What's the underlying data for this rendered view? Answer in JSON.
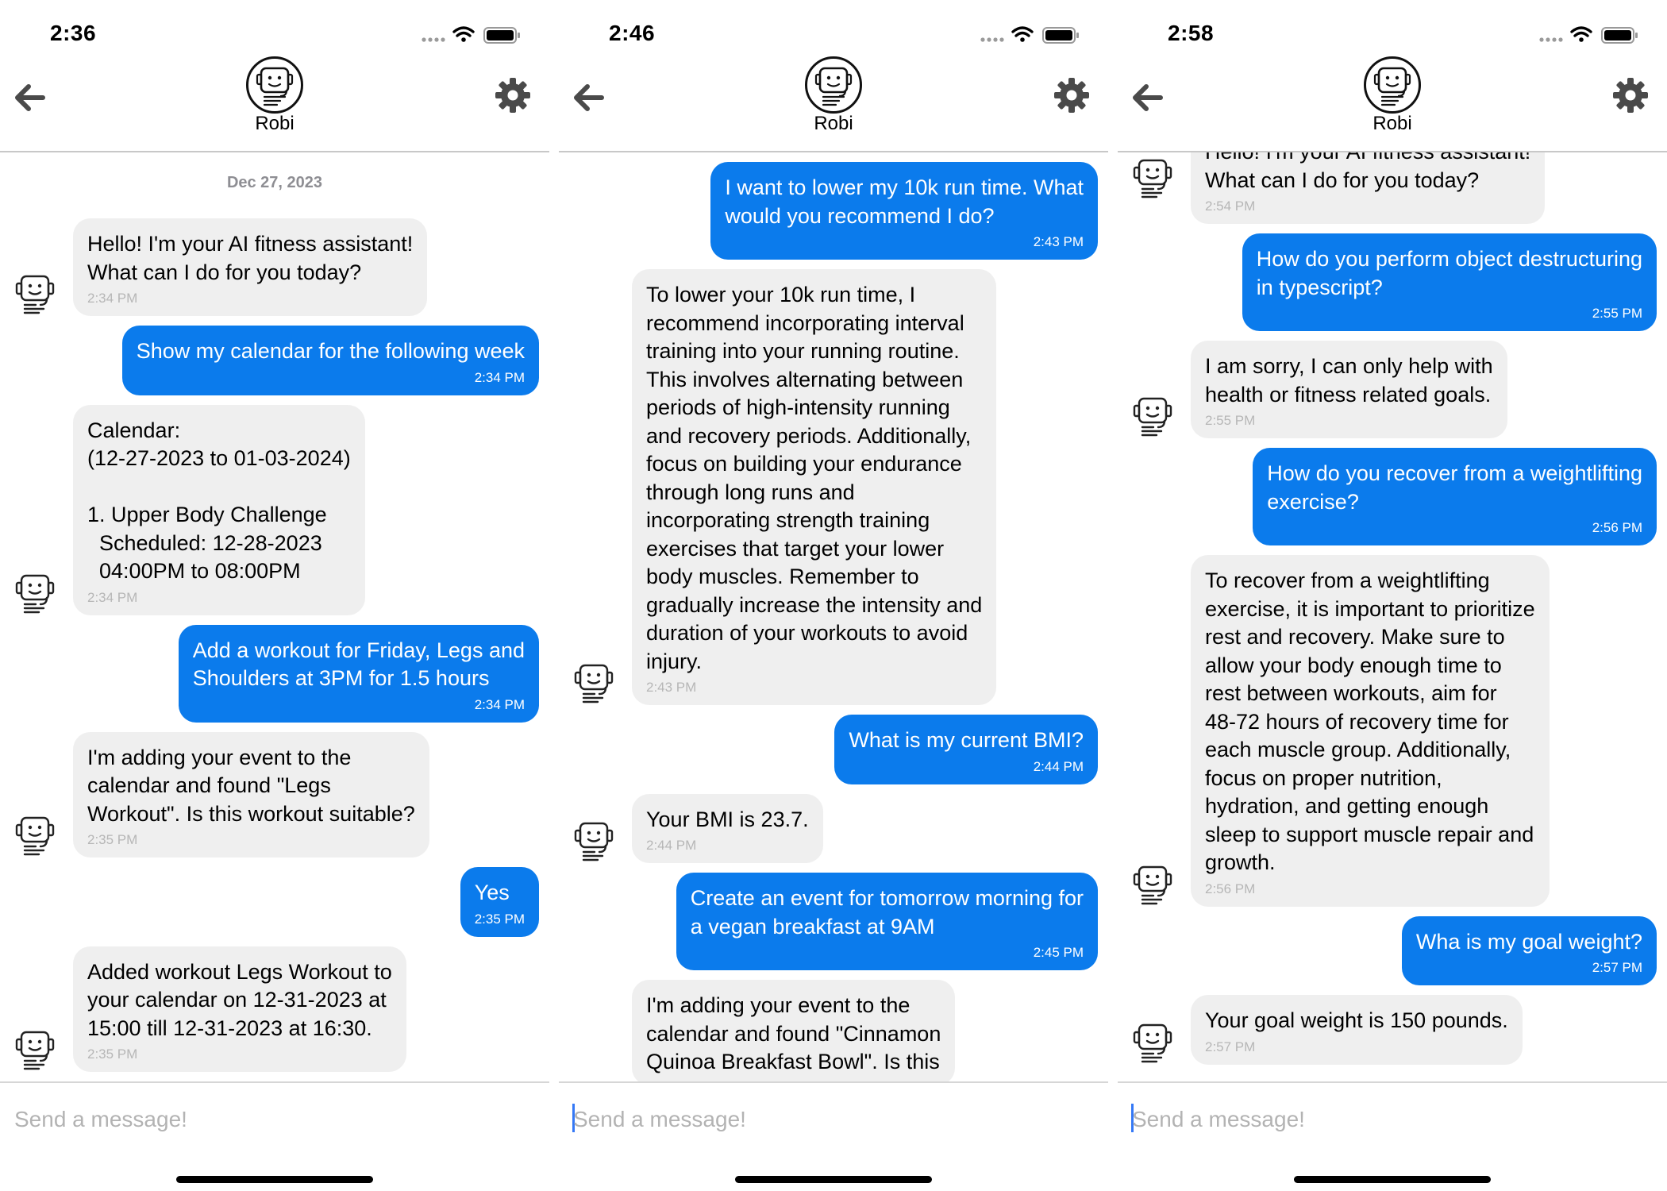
{
  "colors": {
    "outgoing_bubble": "#0b7bec",
    "incoming_bubble": "#efefef",
    "timestamp_gray": "#b6b6b6"
  },
  "screens": [
    {
      "time": "2:36",
      "header": {
        "name": "Robi",
        "back_icon": "arrow-left-icon",
        "settings_icon": "gear-icon"
      },
      "date_label": "Dec 27, 2023",
      "messages": [
        {
          "from": "bot",
          "text": "Hello! I'm your AI fitness assistant!\nWhat can I do for you today?",
          "time": "2:34 PM"
        },
        {
          "from": "user",
          "text": "Show my calendar for the following week",
          "time": "2:34 PM"
        },
        {
          "from": "bot",
          "text": "Calendar:\n(12-27-2023 to 01-03-2024)\n\n1. Upper Body Challenge\n  Scheduled: 12-28-2023\n  04:00PM to 08:00PM",
          "time": "2:34 PM"
        },
        {
          "from": "user",
          "text": "Add a workout for Friday, Legs and\nShoulders at 3PM for 1.5 hours",
          "time": "2:34 PM"
        },
        {
          "from": "bot",
          "text": "I'm adding your event to the\ncalendar and found \"Legs\nWorkout\". Is this workout suitable?",
          "time": "2:35 PM"
        },
        {
          "from": "user",
          "text": "Yes",
          "time": "2:35 PM"
        },
        {
          "from": "bot",
          "text": "Added workout Legs Workout to\nyour calendar on 12-31-2023 at\n15:00 till 12-31-2023 at 16:30.",
          "time": "2:35 PM"
        }
      ],
      "composer": {
        "placeholder": "Send a message!"
      }
    },
    {
      "time": "2:46",
      "header": {
        "name": "Robi",
        "back_icon": "arrow-left-icon",
        "settings_icon": "gear-icon"
      },
      "messages": [
        {
          "from": "user",
          "text": "I want to lower my 10k run time. What\nwould you recommend I do?",
          "time": "2:43 PM"
        },
        {
          "from": "bot",
          "text": "To lower your 10k run time, I\nrecommend incorporating interval\ntraining into your running routine.\nThis involves alternating between\nperiods of high-intensity running\nand recovery periods. Additionally,\nfocus on building your endurance\nthrough long runs and\nincorporating strength training\nexercises that target your lower\nbody muscles. Remember to\ngradually increase the intensity and\nduration of your workouts to avoid\ninjury.",
          "time": "2:43 PM"
        },
        {
          "from": "user",
          "text": "What is my current BMI?",
          "time": "2:44 PM"
        },
        {
          "from": "bot",
          "text": "Your BMI is 23.7.",
          "time": "2:44 PM"
        },
        {
          "from": "user",
          "text": "Create an event for tomorrow morning for\na vegan breakfast at 9AM",
          "time": "2:45 PM"
        },
        {
          "from": "bot",
          "text": "I'm adding your event to the\ncalendar and found \"Cinnamon\nQuinoa Breakfast Bowl\". Is this",
          "time": ""
        }
      ],
      "composer": {
        "placeholder": "Send a message!"
      }
    },
    {
      "time": "2:58",
      "header": {
        "name": "Robi",
        "back_icon": "arrow-left-icon",
        "settings_icon": "gear-icon"
      },
      "messages": [
        {
          "from": "bot",
          "text": "Hello! I'm your AI fitness assistant!\nWhat can I do for you today?",
          "time": "2:54 PM"
        },
        {
          "from": "user",
          "text": "How do you perform object destructuring\nin typescript?",
          "time": "2:55 PM"
        },
        {
          "from": "bot",
          "text": "I am sorry, I can only help with\nhealth or fitness related goals.",
          "time": "2:55 PM"
        },
        {
          "from": "user",
          "text": "How do you recover from a weightlifting\nexercise?",
          "time": "2:56 PM"
        },
        {
          "from": "bot",
          "text": "To recover from a weightlifting\nexercise, it is important to prioritize\nrest and recovery. Make sure to\nallow your body enough time to\nrest between workouts, aim for\n48-72 hours of recovery time for\neach muscle group. Additionally,\nfocus on proper nutrition,\nhydration, and getting enough\nsleep to support muscle repair and\ngrowth.",
          "time": "2:56 PM"
        },
        {
          "from": "user",
          "text": "Wha is my goal weight?",
          "time": "2:57 PM"
        },
        {
          "from": "bot",
          "text": "Your goal weight is 150 pounds.",
          "time": "2:57 PM"
        }
      ],
      "composer": {
        "placeholder": "Send a message!"
      }
    }
  ]
}
